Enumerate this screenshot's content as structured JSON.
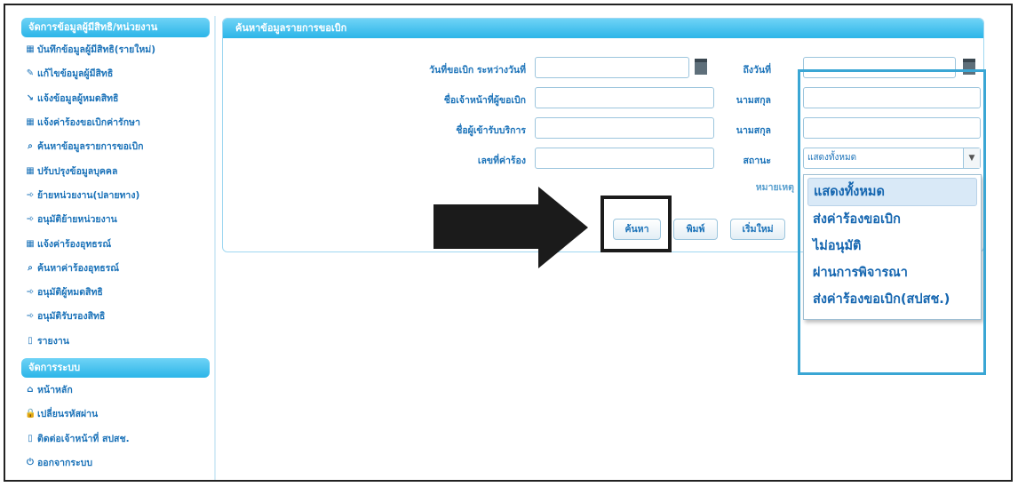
{
  "sidebar": {
    "section1_title": "จัดการข้อมูลผู้มีสิทธิ/หน่วยงาน",
    "items": [
      {
        "icon": "grid-icon",
        "glyph": "▦",
        "label": "บันทึกข้อมูลผู้มีสิทธิ(รายใหม่)"
      },
      {
        "icon": "pencil-icon",
        "glyph": "✎",
        "label": "แก้ไขข้อมูลผู้มีสิทธิ"
      },
      {
        "icon": "inform-icon",
        "glyph": "↘",
        "label": "แจ้งข้อมูลผู้หมดสิทธิ"
      },
      {
        "icon": "grid-icon",
        "glyph": "▦",
        "label": "แจ้งค่าร้องขอเบิกค่ารักษา"
      },
      {
        "icon": "search-icon",
        "glyph": "⌕",
        "label": "ค้นหาข้อมูลรายการขอเบิก"
      },
      {
        "icon": "grid-icon",
        "glyph": "▦",
        "label": "ปรับปรุงข้อมูลบุคคล"
      },
      {
        "icon": "arrow-icon",
        "glyph": "➾",
        "label": "ย้ายหน่วยงาน(ปลายทาง)"
      },
      {
        "icon": "arrow-icon",
        "glyph": "➾",
        "label": "อนุมัติย้ายหน่วยงาน"
      },
      {
        "icon": "grid-icon",
        "glyph": "▦",
        "label": "แจ้งค่าร้องอุทธรณ์"
      },
      {
        "icon": "search-icon",
        "glyph": "⌕",
        "label": "ค้นหาค่าร้องอุทธรณ์"
      },
      {
        "icon": "arrow-icon",
        "glyph": "➾",
        "label": "อนุมัติผู้หมดสิทธิ"
      },
      {
        "icon": "arrow-icon",
        "glyph": "➾",
        "label": "อนุมัติรับรองสิทธิ"
      },
      {
        "icon": "document-icon",
        "glyph": "▯",
        "label": "รายงาน"
      }
    ],
    "section2_title": "จัดการระบบ",
    "items2": [
      {
        "icon": "home-icon",
        "glyph": "⌂",
        "label": "หน้าหลัก"
      },
      {
        "icon": "lock-icon",
        "glyph": "🔒",
        "label": "เปลี่ยนรหัสผ่าน"
      },
      {
        "icon": "document-icon",
        "glyph": "▯",
        "label": "ติดต่อเจ้าหน้าที่ สปสช."
      },
      {
        "icon": "power-icon",
        "glyph": "⏻",
        "label": "ออกจากระบบ"
      }
    ]
  },
  "panel": {
    "title": "ค้นหาข้อมูลรายการขอเบิก",
    "fields": {
      "date_from_label": "วันที่ขอเบิก ระหว่างวันที่",
      "date_to_label": "ถึงวันที่",
      "officer_name_label": "ชื่อเจ้าหน้าที่ผู้ขอเบิก",
      "officer_surname_label": "นามสกุล",
      "patient_name_label": "ชื่อผู้เข้ารับบริการ",
      "patient_surname_label": "นามสกุล",
      "request_no_label": "เลขที่ค่าร้อง",
      "status_label": "สถานะ",
      "remark_label": "หมายเหตุ",
      "status_value": "แสดงทั้งหมด"
    },
    "buttons": {
      "search": "ค้นหา",
      "print": "พิมพ์",
      "reset": "เริ่มใหม่"
    }
  },
  "status_options": [
    "แสดงทั้งหมด",
    "ส่งค่าร้องขอเบิก",
    "ไม่อนุมัติ",
    "ผ่านการพิจารณา",
    "ส่งค่าร้องขอเบิก(สปสช.)"
  ],
  "colors": {
    "header_blue": "#2bb5e8",
    "text_blue": "#1c73b9",
    "annotation_black": "#1b1b1b",
    "annotation_blue": "#3aa6d4"
  }
}
